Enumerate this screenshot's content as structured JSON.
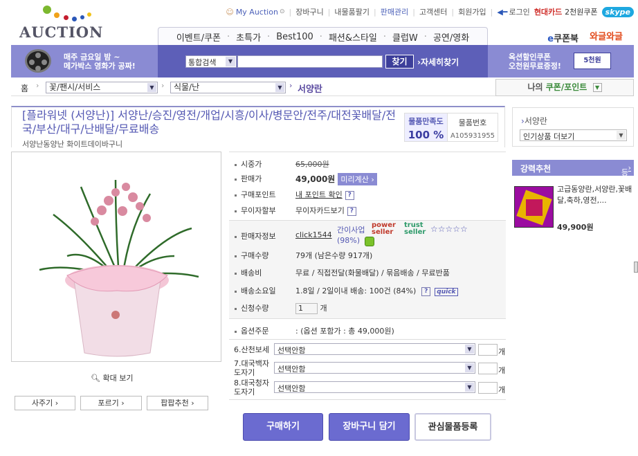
{
  "header": {
    "logo": "AUCTION",
    "links": [
      "My Auction",
      "장바구니",
      "내물품팔기",
      "판매관리",
      "고객센터",
      "회원가입"
    ],
    "login": "로그인",
    "hd_card": "현대카드",
    "hd_card_coupon": "2천원쿠폰",
    "skype": "skype",
    "nav": [
      "이벤트/쿠폰",
      "초특가",
      "Best100",
      "패션&스타일",
      "클럽W",
      "공연/영화"
    ],
    "ecoupon_prefix": "e",
    "ecoupon": "쿠폰북",
    "walkwa": "와글와글"
  },
  "banner": {
    "left_line1": "매주 금요일 밤 ~",
    "left_line2": "메가박스 영화가 공짜!",
    "right_line1": "옥션할인쿠폰",
    "right_line2": "오천원무료증정!",
    "right_badge": "5천원"
  },
  "search": {
    "category": "통합검색",
    "button": "찾기",
    "detail": "자세히찾기"
  },
  "breadcrumb": {
    "home": "홈",
    "level1": "꽃/팬시/서비스",
    "level2": "식물/난",
    "current": "서양란"
  },
  "mycoupon": {
    "prefix": "나의 ",
    "main": "쿠폰/포인트"
  },
  "product": {
    "title": "[플라워넷 (서양난)] 서양난/승진/영전/개업/시흥/이사/병문안/전주/대전꽃배달/전국/부산/대구/난배달/무료배송",
    "subtitle": "서양난동양난 화이트데이바구니",
    "satisfaction_label": "물품만족도",
    "satisfaction_value": "100 %",
    "item_no_label": "물품번호",
    "item_no": "A105931955",
    "zoom": "확대 보기"
  },
  "actions": {
    "buy_now": "사주기",
    "forward": "포르기",
    "recommend": "팝팝추천"
  },
  "details": {
    "list_price_label": "시중가",
    "list_price": "65,000원",
    "price_label": "판매가",
    "price": "49,000원",
    "calc": "미리계산",
    "point_label": "구매포인트",
    "point": "내 포인트 확인",
    "installment_label": "무이자할부",
    "installment": "무이자카드보기",
    "seller_label": "판매자정보",
    "seller": "click1544",
    "seller_grade": "간이사업",
    "seller_rate": "(98%)",
    "power_seller": "power seller",
    "trust_seller": "trust seller",
    "stars": "☆☆☆☆☆",
    "qty_label": "구매수량",
    "qty": "79개 (남은수량 917개)",
    "shipping_label": "배송비",
    "shipping": "무료 / 직접전달(화물배달) / 묶음배송 / 무료반품",
    "delivery_label": "배송소요일",
    "delivery": "1.8일 / 2일이내 배송: 100건 (84%)",
    "quick": "quick",
    "request_label": "신청수량",
    "request_qty": "1",
    "request_unit": "개",
    "option_label": "옵션주문",
    "option_total": ":  (옵션 포함가 : 총 49,000원)"
  },
  "options": [
    {
      "label": "6.산천보세",
      "value": "선택안함",
      "unit": "개"
    },
    {
      "label": "7.대국백자도자기",
      "value": "선택안함",
      "unit": "개"
    },
    {
      "label": "8.대국청자도자기",
      "value": "선택안함",
      "unit": "개"
    }
  ],
  "buttons": {
    "buy": "구매하기",
    "cart": "장바구니 담기",
    "favorite": "관심물품등록"
  },
  "sidebar": {
    "category": "서양란",
    "popular": "인기상품 더보기",
    "strong": "강력추천",
    "register": "등록하기",
    "item_desc": "고급동양란,서양란,꽃배달,축하,영전,...",
    "item_price": "49,900원"
  }
}
